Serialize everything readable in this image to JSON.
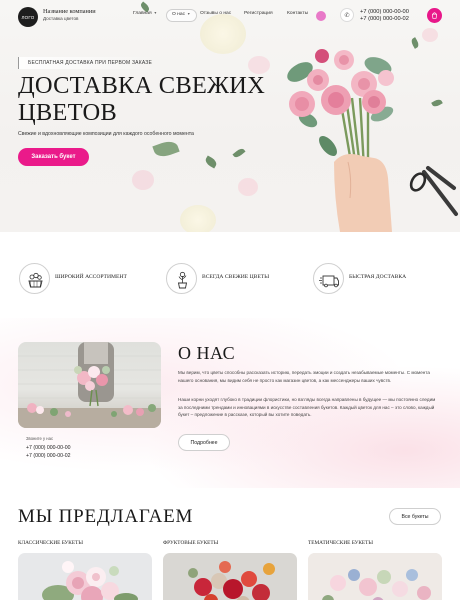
{
  "header": {
    "logo_text": "ЛОГО",
    "company_name": "Название компании",
    "company_sub": "Доставка цветов",
    "nav": [
      {
        "label": "Главная",
        "dropdown": true
      },
      {
        "label": "О нас",
        "dropdown": true,
        "active": true
      },
      {
        "label": "Отзывы о нас",
        "dropdown": false
      },
      {
        "label": "Регистрация",
        "dropdown": false
      },
      {
        "label": "Контакты",
        "dropdown": false
      }
    ],
    "phones": [
      "+7 (000) 000-00-00",
      "+7 (000) 000-00-02"
    ],
    "icons": {
      "phone": "phone-icon",
      "cart": "cart-icon"
    }
  },
  "hero": {
    "promo": "Бесплатная доставка при первом заказе",
    "title_line1": "Доставка свежих",
    "title_line2": "цветов",
    "subtitle": "Свежие и вдохновляющие композиции для каждого особенного момента",
    "cta": "Заказать букет"
  },
  "features": [
    {
      "label": "Широкий ассортимент",
      "icon": "flower-basket-icon"
    },
    {
      "label": "Всегда свежие цветы",
      "icon": "flower-pot-icon"
    },
    {
      "label": "Быстрая доставка",
      "icon": "delivery-box-icon"
    }
  ],
  "about": {
    "title": "О нас",
    "p1": "Мы верим, что цветы способны рассказать историю, передать эмоции и создать незабываемые моменты. С момента нашего основания, мы видим себя не просто как магазин цветов, а как мессенджеры ваших чувств.",
    "p2": "Наши корни уходят глубоко в традиции флористики, но взгляды всегда направлены в будущее — мы постоянно следим за последними трендами и инновациями в искусстве составления букетов. Каждый цветок для нас – это слово, каждый букет – предложение в рассказе, который вы хотите поведать.",
    "more": "Подробнее",
    "contact_caption": "Звоните у нас",
    "phones": [
      "+7 (000) 000-00-00",
      "+7 (000) 000-00-02"
    ]
  },
  "offers": {
    "title": "Мы предлагаем",
    "all_button": "Все букеты",
    "categories": [
      {
        "title": "Классические букеты"
      },
      {
        "title": "Фруктовые букеты"
      },
      {
        "title": "Тематические букеты"
      }
    ]
  },
  "colors": {
    "accent": "#ea1a8a",
    "nav_badge": "#e879c8",
    "text": "#1a1a1a"
  }
}
